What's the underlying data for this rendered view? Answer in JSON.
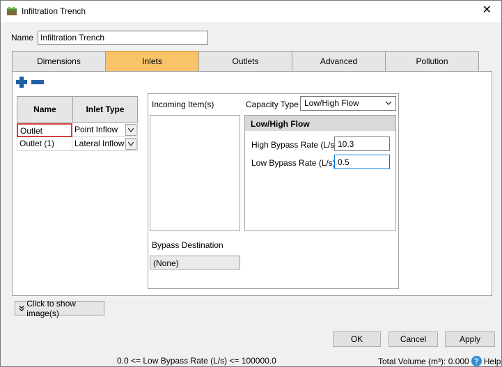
{
  "window": {
    "title": "Infiltration Trench",
    "close_glyph": "✕"
  },
  "name_field": {
    "label": "Name",
    "value": "Infiltration Trench"
  },
  "tabs": [
    {
      "label": "Dimensions",
      "active": false
    },
    {
      "label": "Inlets",
      "active": true
    },
    {
      "label": "Outlets",
      "active": false
    },
    {
      "label": "Advanced",
      "active": false
    },
    {
      "label": "Pollution",
      "active": false
    }
  ],
  "inlets_grid": {
    "headers": [
      "Name",
      "Inlet Type"
    ],
    "rows": [
      {
        "name": "Outlet",
        "type": "Point Inflow",
        "selected": true
      },
      {
        "name": "Outlet (1)",
        "type": "Lateral Inflow",
        "selected": false
      }
    ]
  },
  "incoming": {
    "label": "Incoming Item(s)"
  },
  "capacity": {
    "label": "Capacity Type",
    "value": "Low/High Flow"
  },
  "low_high": {
    "heading": "Low/High Flow",
    "high_label": "High Bypass Rate (L/s)",
    "high_value": "10.3",
    "low_label": "Low Bypass Rate (L/s)",
    "low_value": "0.5"
  },
  "bypass": {
    "label": "Bypass Destination",
    "value": "(None)"
  },
  "show_images": {
    "label": "Click to show image(s)"
  },
  "buttons": {
    "ok": "OK",
    "cancel": "Cancel",
    "apply": "Apply"
  },
  "status": {
    "hint": "0.0 <= Low Bypass Rate (L/s) <= 100000.0",
    "total_volume": "Total Volume (m³): 0.000",
    "help": "Help"
  },
  "colors": {
    "active_tab": "#f9c369",
    "accent_blue": "#1f5fa6",
    "focus_border": "#0078d7",
    "selected_cell": "#d04040"
  }
}
